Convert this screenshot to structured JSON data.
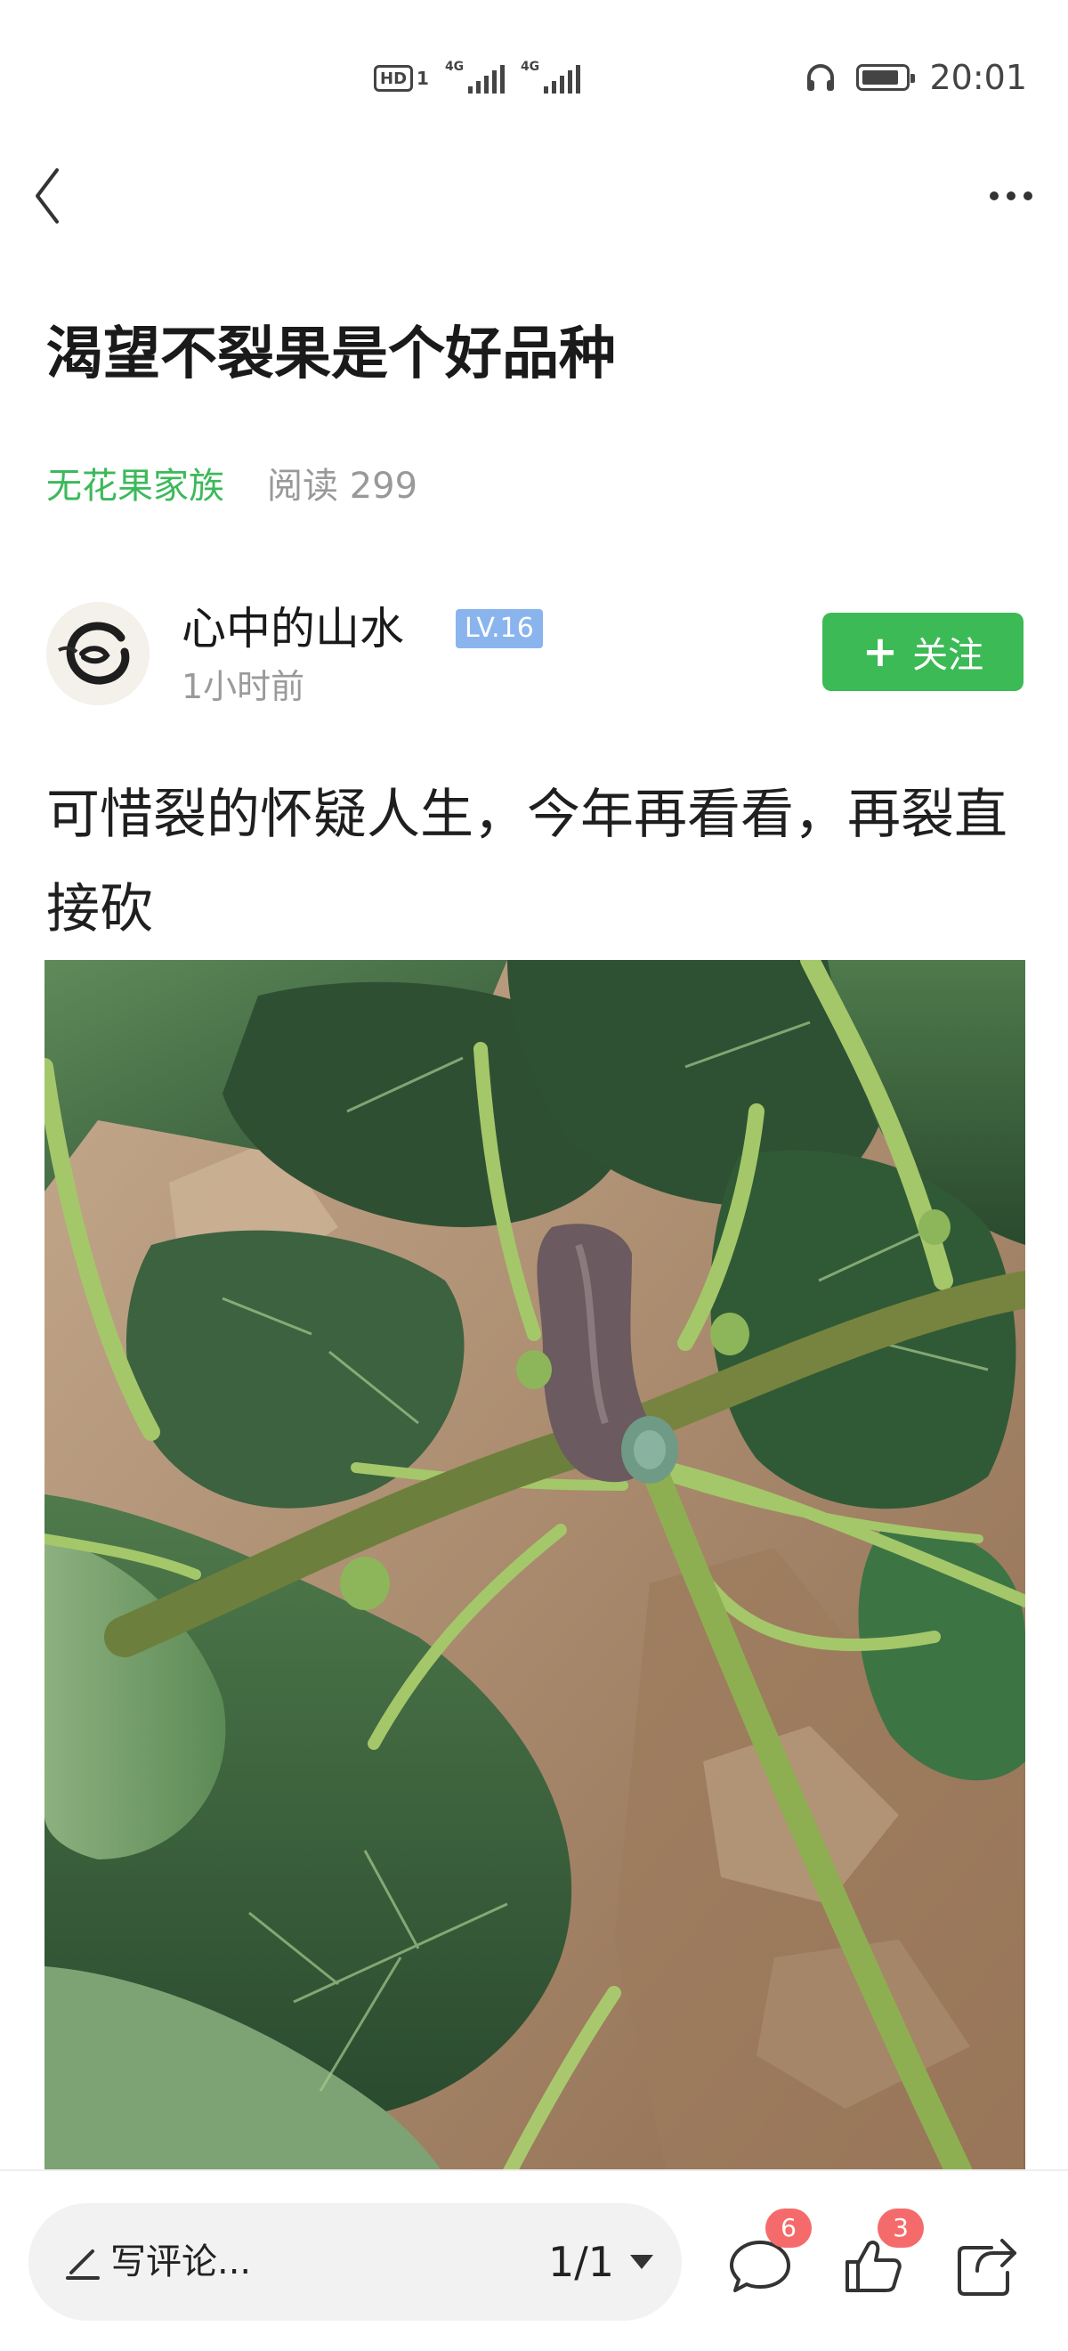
{
  "status_bar": {
    "hd_label": "HD",
    "sim_number": "1",
    "network_1": "4G",
    "network_2": "4G",
    "battery_level": 0.85,
    "time": "20:01"
  },
  "article": {
    "title": "渴望不裂果是个好品种",
    "circle": "无花果家族",
    "reads": "阅读 299",
    "body": "可惜裂的怀疑人生，今年再看看，再裂直接砍"
  },
  "author": {
    "name": "心中的山水",
    "level": "LV.16",
    "time": "1小时前",
    "follow_label": "关注",
    "follow_color": "#3cba55"
  },
  "bottom_bar": {
    "comment_placeholder": "写评论...",
    "page_indicator": "1/1",
    "comment_count": "6",
    "like_count": "3",
    "badge_color": "#f56b6b"
  },
  "icons": {
    "back": "chevron-left-icon",
    "more": "more-horizontal-icon",
    "pencil": "pencil-icon",
    "comment": "comment-bubble-icon",
    "like": "thumbs-up-icon",
    "share": "share-icon",
    "headphones": "headphones-icon",
    "battery": "battery-icon"
  }
}
